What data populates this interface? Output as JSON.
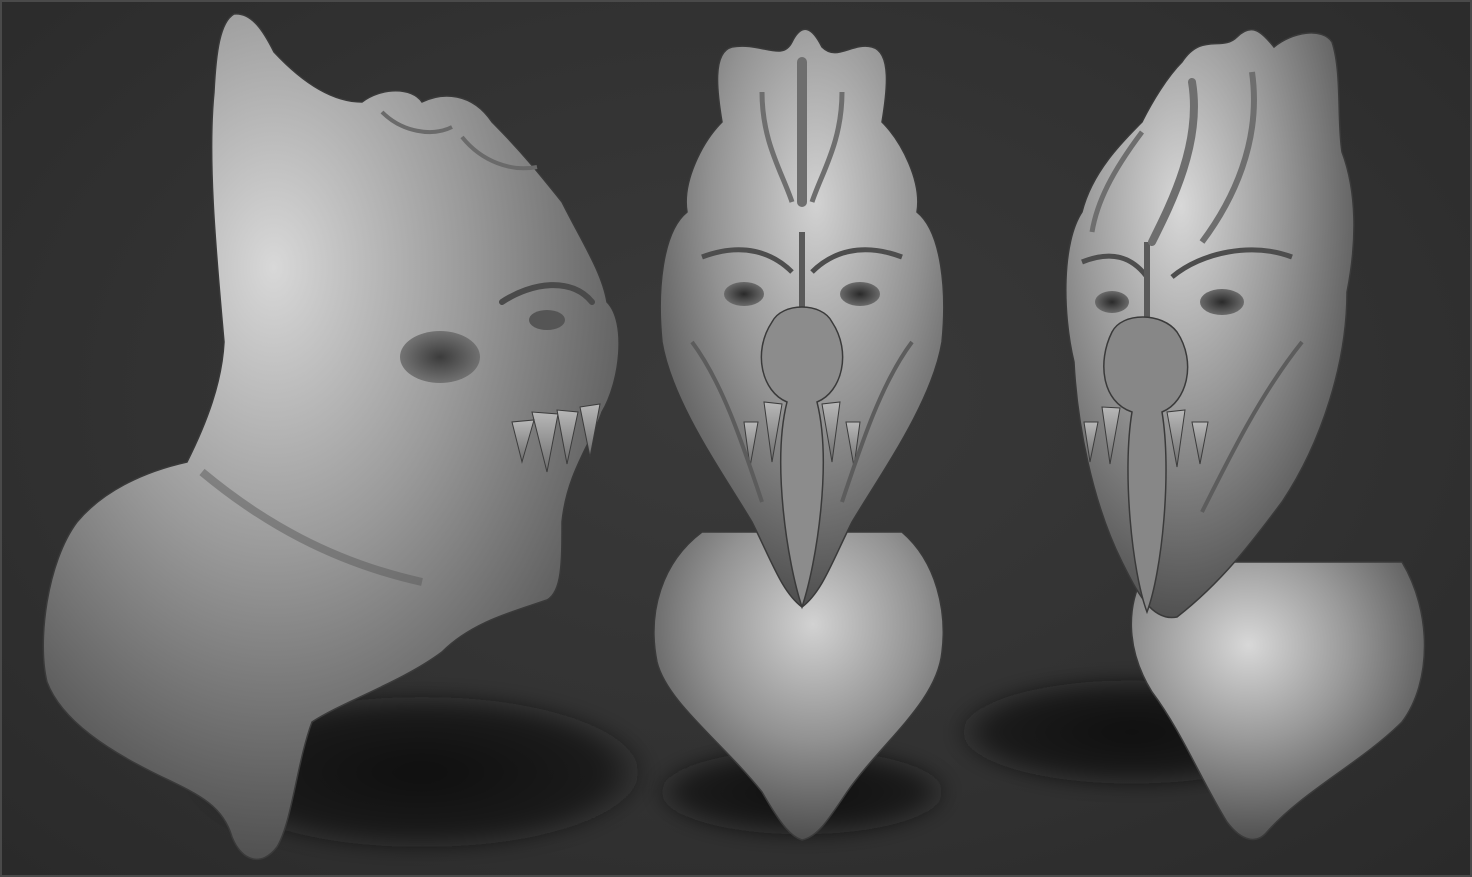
{
  "scene": {
    "background_color": "#333333",
    "frame_color": "#4a4a4a",
    "clay_light": "#d6d6d6",
    "clay_mid": "#8e8e8e",
    "clay_dark": "#3c3c3c",
    "shadow_color": "#111111",
    "views": [
      "side-view",
      "front-view",
      "three-quarter-view"
    ]
  }
}
